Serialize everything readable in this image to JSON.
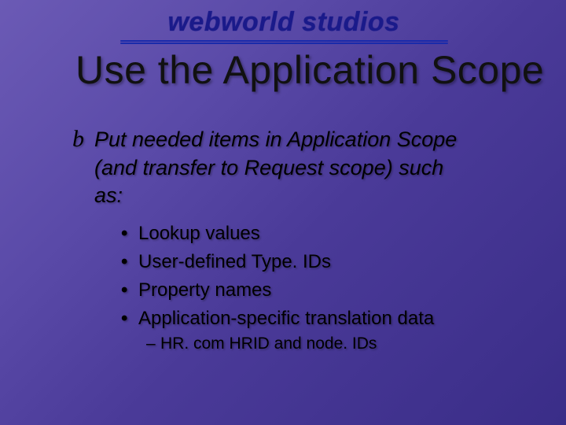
{
  "logo": {
    "text": "webworld studios"
  },
  "title": "Use the Application Scope",
  "main_point": {
    "marker": "b",
    "line1": "Put needed items in Application Scope",
    "line2": "(and transfer to Request scope) such",
    "line3": "as:"
  },
  "sub_items": [
    "Lookup values",
    "User-defined Type. IDs",
    "Property names",
    "Application-specific translation data"
  ],
  "subsub_item": "HR. com HRID and node. IDs",
  "markers": {
    "bullet": "•",
    "dash": "–"
  }
}
